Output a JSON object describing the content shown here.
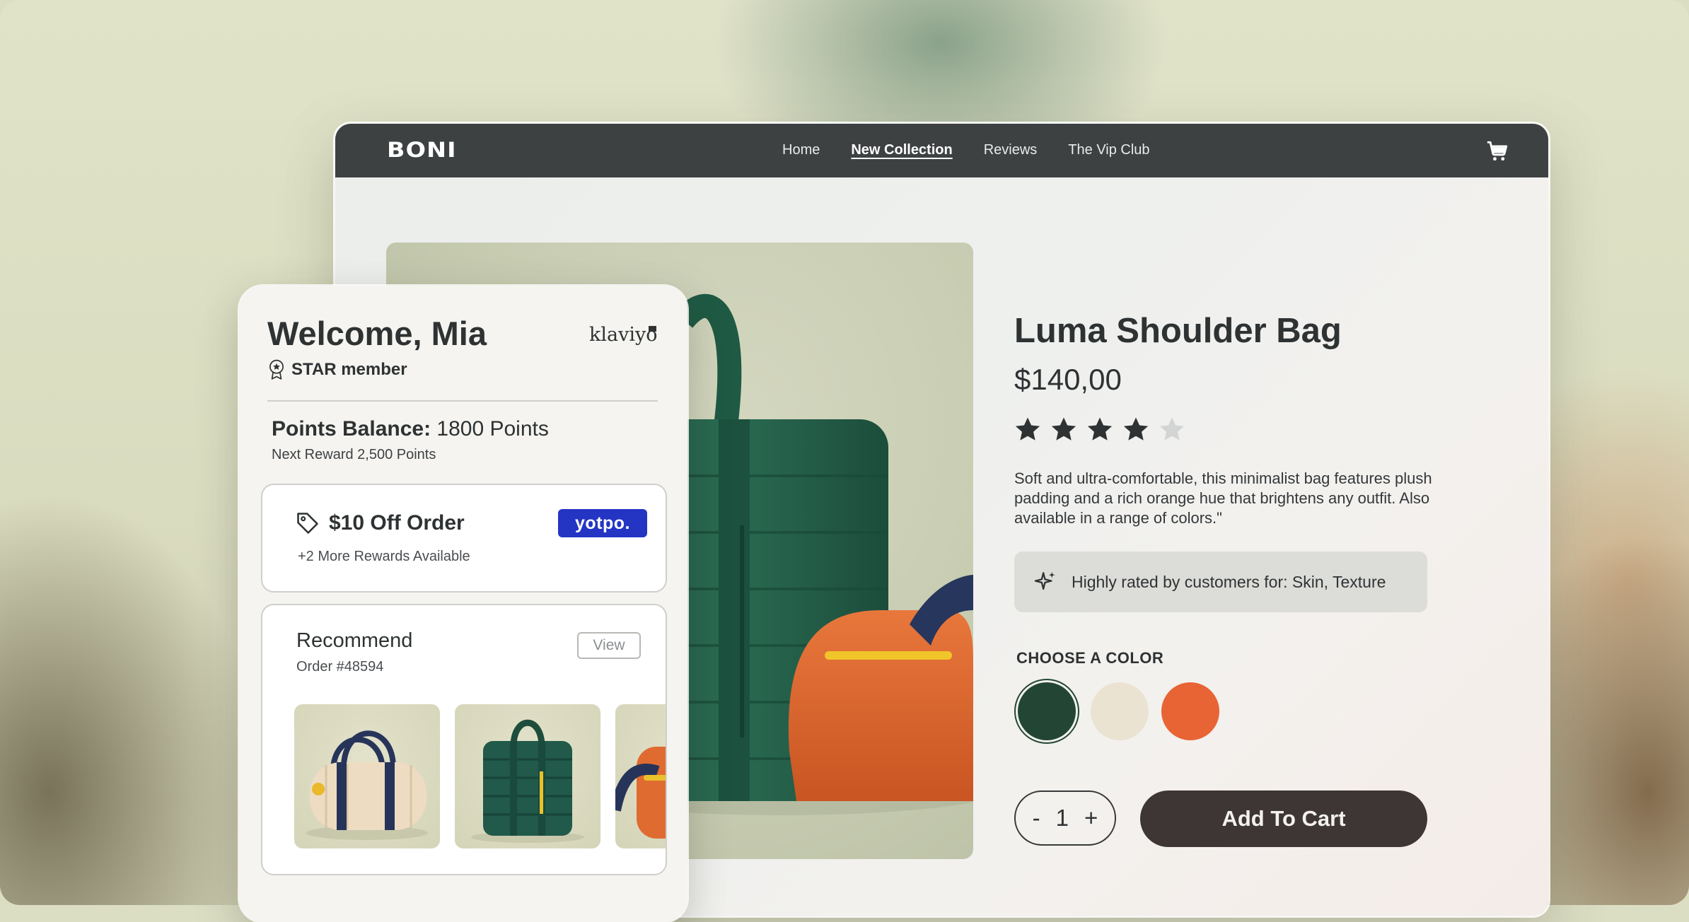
{
  "site": {
    "logo": "BONI",
    "nav": [
      "Home",
      "New Collection",
      "Reviews",
      "The Vip Club"
    ],
    "active_nav": "New Collection"
  },
  "product": {
    "title": "Luma Shoulder Bag",
    "price": "$140,00",
    "rating": 4,
    "rating_max": 5,
    "description": "Soft and ultra-comfortable, this minimalist bag features plush padding and a rich orange hue that brightens any outfit. Also available in a range of colors.\"",
    "highlight": "Highly rated by customers for: Skin, Texture",
    "choose_color_label": "CHOOSE A COLOR",
    "colors": [
      "#234634",
      "#ebe3d1",
      "#e86434"
    ],
    "selected_color": "#234634",
    "quantity": "1",
    "qty_minus": "-",
    "qty_plus": "+",
    "add_to_cart": "Add To Cart"
  },
  "loyalty": {
    "welcome": "Welcome, Mia",
    "brand": "klaviyo",
    "member_status": "STAR member",
    "points_label": "Points Balance:",
    "points_value": "1800 Points",
    "next_reward": "Next Reward 2,500 Points",
    "offer": {
      "title": "$10 Off Order",
      "more": "+2 More Rewards Available",
      "partner": "yotpo."
    },
    "recommend": {
      "title": "Recommend",
      "order": "Order #48594",
      "view": "View"
    }
  },
  "colors": {
    "navbar": "#3e4142",
    "dark_text": "#2e3233",
    "cta": "#3d3634",
    "yotpo_blue": "#2435c4"
  }
}
